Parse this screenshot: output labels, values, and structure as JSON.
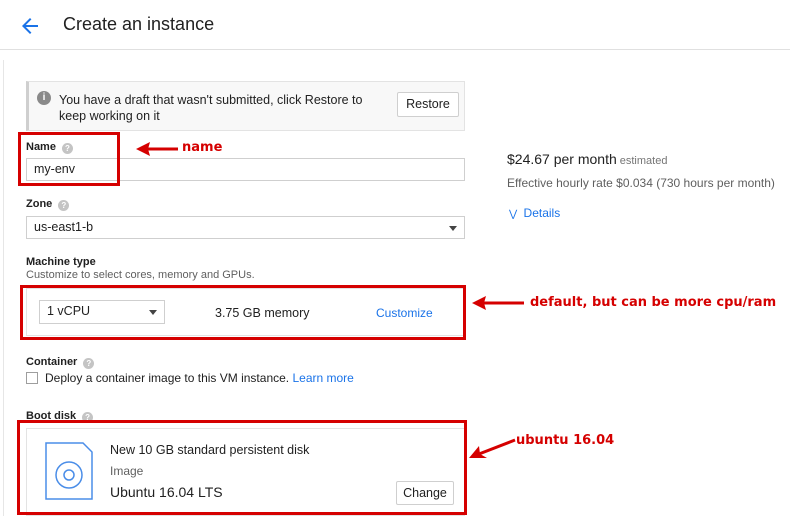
{
  "header": {
    "title": "Create an instance",
    "back_icon": "arrow-left-icon"
  },
  "draft_notice": {
    "icon": "info-icon",
    "text": "You have a draft that wasn't submitted, click Restore to keep working on it",
    "restore_label": "Restore"
  },
  "name": {
    "label": "Name",
    "value": "my-env"
  },
  "zone": {
    "label": "Zone",
    "value": "us-east1-b"
  },
  "pricing": {
    "monthly": "$24.67 per month",
    "estimated": "estimated",
    "hourly": "Effective hourly rate $0.034 (730 hours per month)",
    "details_label": "Details"
  },
  "machine_type": {
    "label": "Machine type",
    "hint": "Customize to select cores, memory and GPUs.",
    "cpu": "1 vCPU",
    "memory": "3.75 GB memory",
    "customize_label": "Customize"
  },
  "container": {
    "label": "Container",
    "checkbox_text": "Deploy a container image to this VM instance.",
    "learn_more": "Learn more",
    "checked": false
  },
  "boot_disk": {
    "label": "Boot disk",
    "title": "New 10 GB standard persistent disk",
    "type": "Image",
    "os": "Ubuntu 16.04 LTS",
    "change_label": "Change"
  },
  "annotations": {
    "name": "name",
    "machine": "default, but can be more cpu/ram",
    "boot": "ubuntu 16.04",
    "color": "#d50000"
  },
  "colors": {
    "link": "#1a73e8",
    "text": "#212121"
  }
}
